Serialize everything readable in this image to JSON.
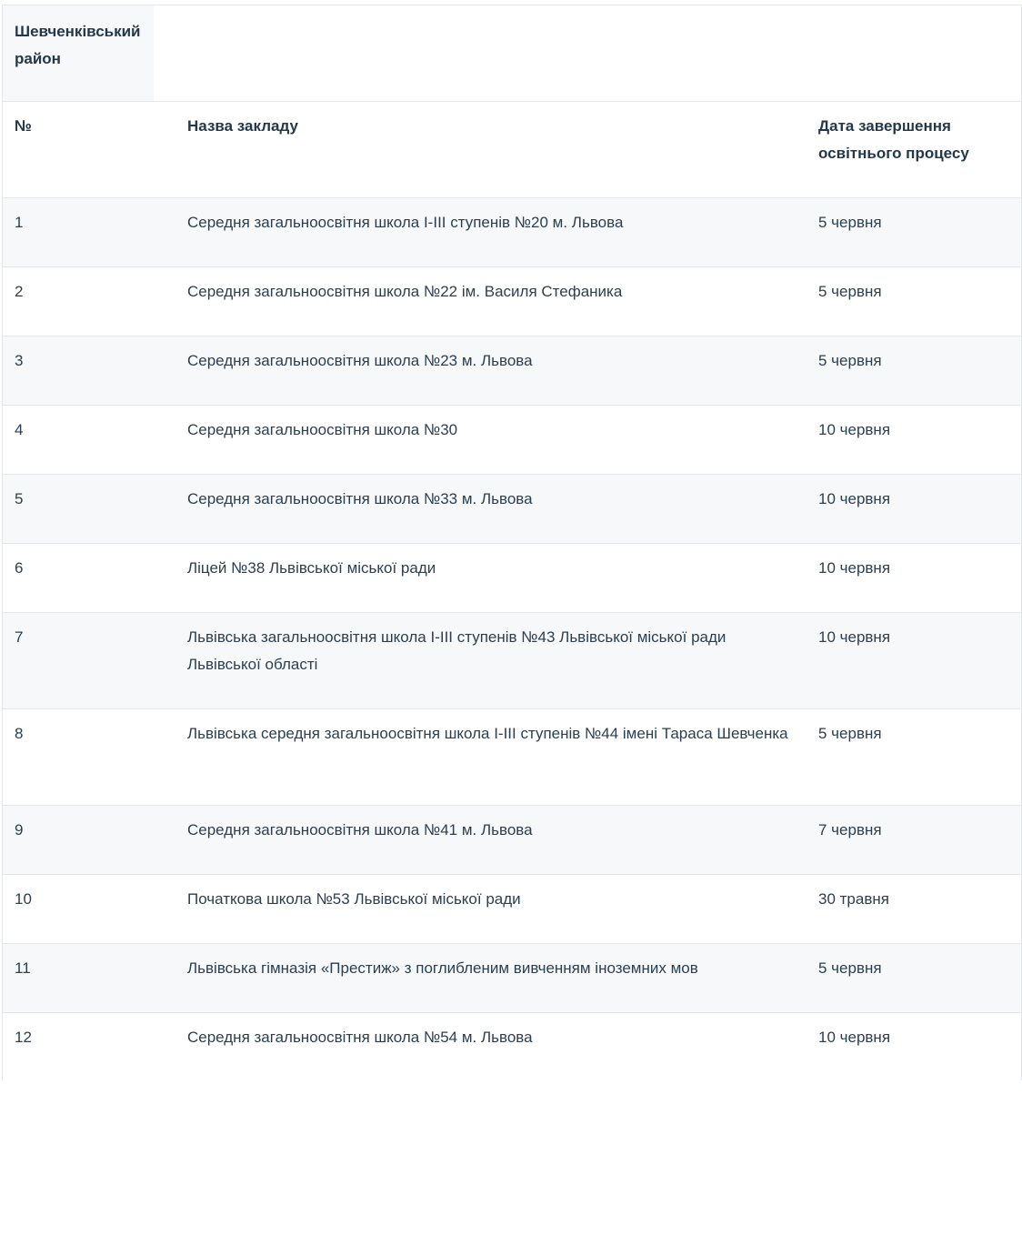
{
  "district": "Шевченківський район",
  "headers": {
    "num": "№",
    "name": "Назва закладу",
    "date": "Дата завершення освітнього процесу"
  },
  "rows": [
    {
      "num": "1",
      "name": "Середня загальноосвітня школа І-ІІІ ступенів №20 м. Львова",
      "date": "5 червня"
    },
    {
      "num": "2",
      "name": "Середня загальноосвітня школа №22 ім. Василя Стефаника",
      "date": "5 червня"
    },
    {
      "num": "3",
      "name": "Середня загальноосвітня школа №23 м. Львова",
      "date": "5 червня"
    },
    {
      "num": "4",
      "name": "Середня загальноосвітня школа №30",
      "date": "10 червня"
    },
    {
      "num": "5",
      "name": "Середня загальноосвітня школа №33 м. Львова",
      "date": "10 червня"
    },
    {
      "num": "6",
      "name": "Ліцей №38 Львівської міської ради",
      "date": "10 червня"
    },
    {
      "num": "7",
      "name": "Львівська загальноосвітня школа І-ІІІ ступенів №43 Львівської міської ради Львівської області",
      "date": "10 червня"
    },
    {
      "num": "8",
      "name": "Львівська середня загальноосвітня школа І-ІІІ ступенів №44 імені Тараса Шевченка",
      "date": "5 червня"
    },
    {
      "num": "9",
      "name": "Середня загальноосвітня школа №41 м. Львова",
      "date": "7 червня"
    },
    {
      "num": "10",
      "name": "Початкова школа №53 Львівської міської ради",
      "date": "30 травня"
    },
    {
      "num": "11",
      "name": "Львівська гімназія «Престиж» з поглибленим вивченням іноземних мов",
      "date": "5 червня"
    },
    {
      "num": "12",
      "name": "Середня загальноосвітня школа №54 м. Львова",
      "date": "10 червня"
    }
  ]
}
